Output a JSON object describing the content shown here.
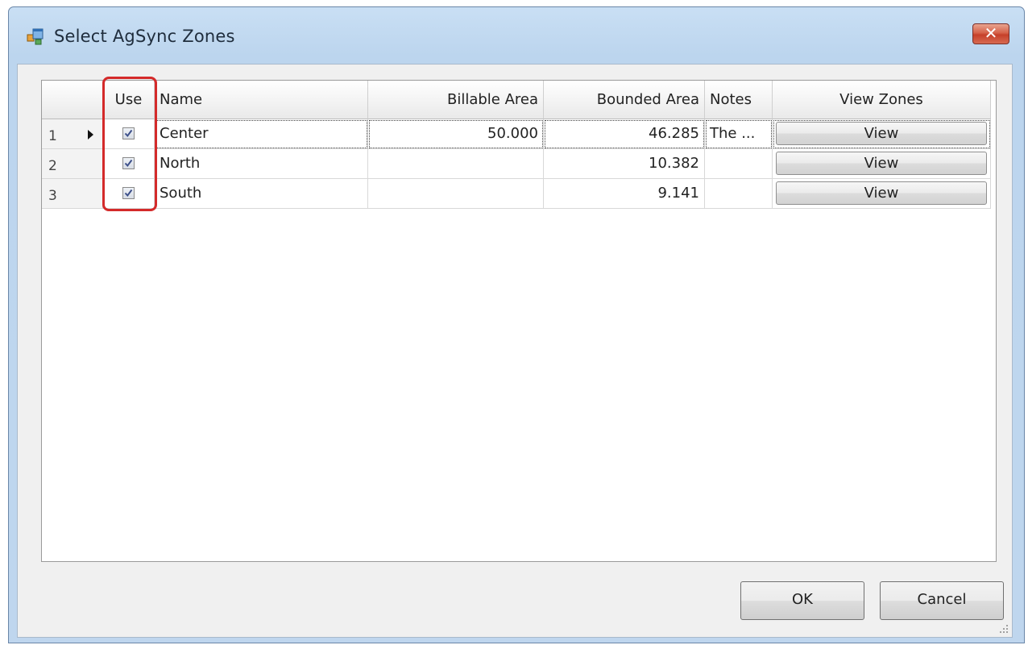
{
  "window": {
    "title": "Select AgSync Zones",
    "close_glyph": "✕"
  },
  "icons": {
    "app": "window-app-icon",
    "close": "close-icon",
    "row_indicator": "current-row-arrow-icon",
    "checkbox": "checkmark-icon",
    "resize": "resize-grip-icon"
  },
  "grid": {
    "columns": {
      "use": "Use",
      "name": "Name",
      "billable_area": "Billable Area",
      "bounded_area": "Bounded Area",
      "notes": "Notes",
      "view_zones": "View Zones"
    },
    "rows": [
      {
        "num": "1",
        "use": true,
        "name": "Center",
        "billable": "50.000",
        "bounded": "46.285",
        "notes": "The ...",
        "view": "View",
        "current": true
      },
      {
        "num": "2",
        "use": true,
        "name": "North",
        "billable": "",
        "bounded": "10.382",
        "notes": "",
        "view": "View",
        "current": false
      },
      {
        "num": "3",
        "use": true,
        "name": "South",
        "billable": "",
        "bounded": "9.141",
        "notes": "",
        "view": "View",
        "current": false
      }
    ]
  },
  "buttons": {
    "ok": "OK",
    "cancel": "Cancel"
  },
  "colors": {
    "highlight": "#d42a2a",
    "title_bar": "#c9dff4",
    "close_button": "#c6402a"
  }
}
